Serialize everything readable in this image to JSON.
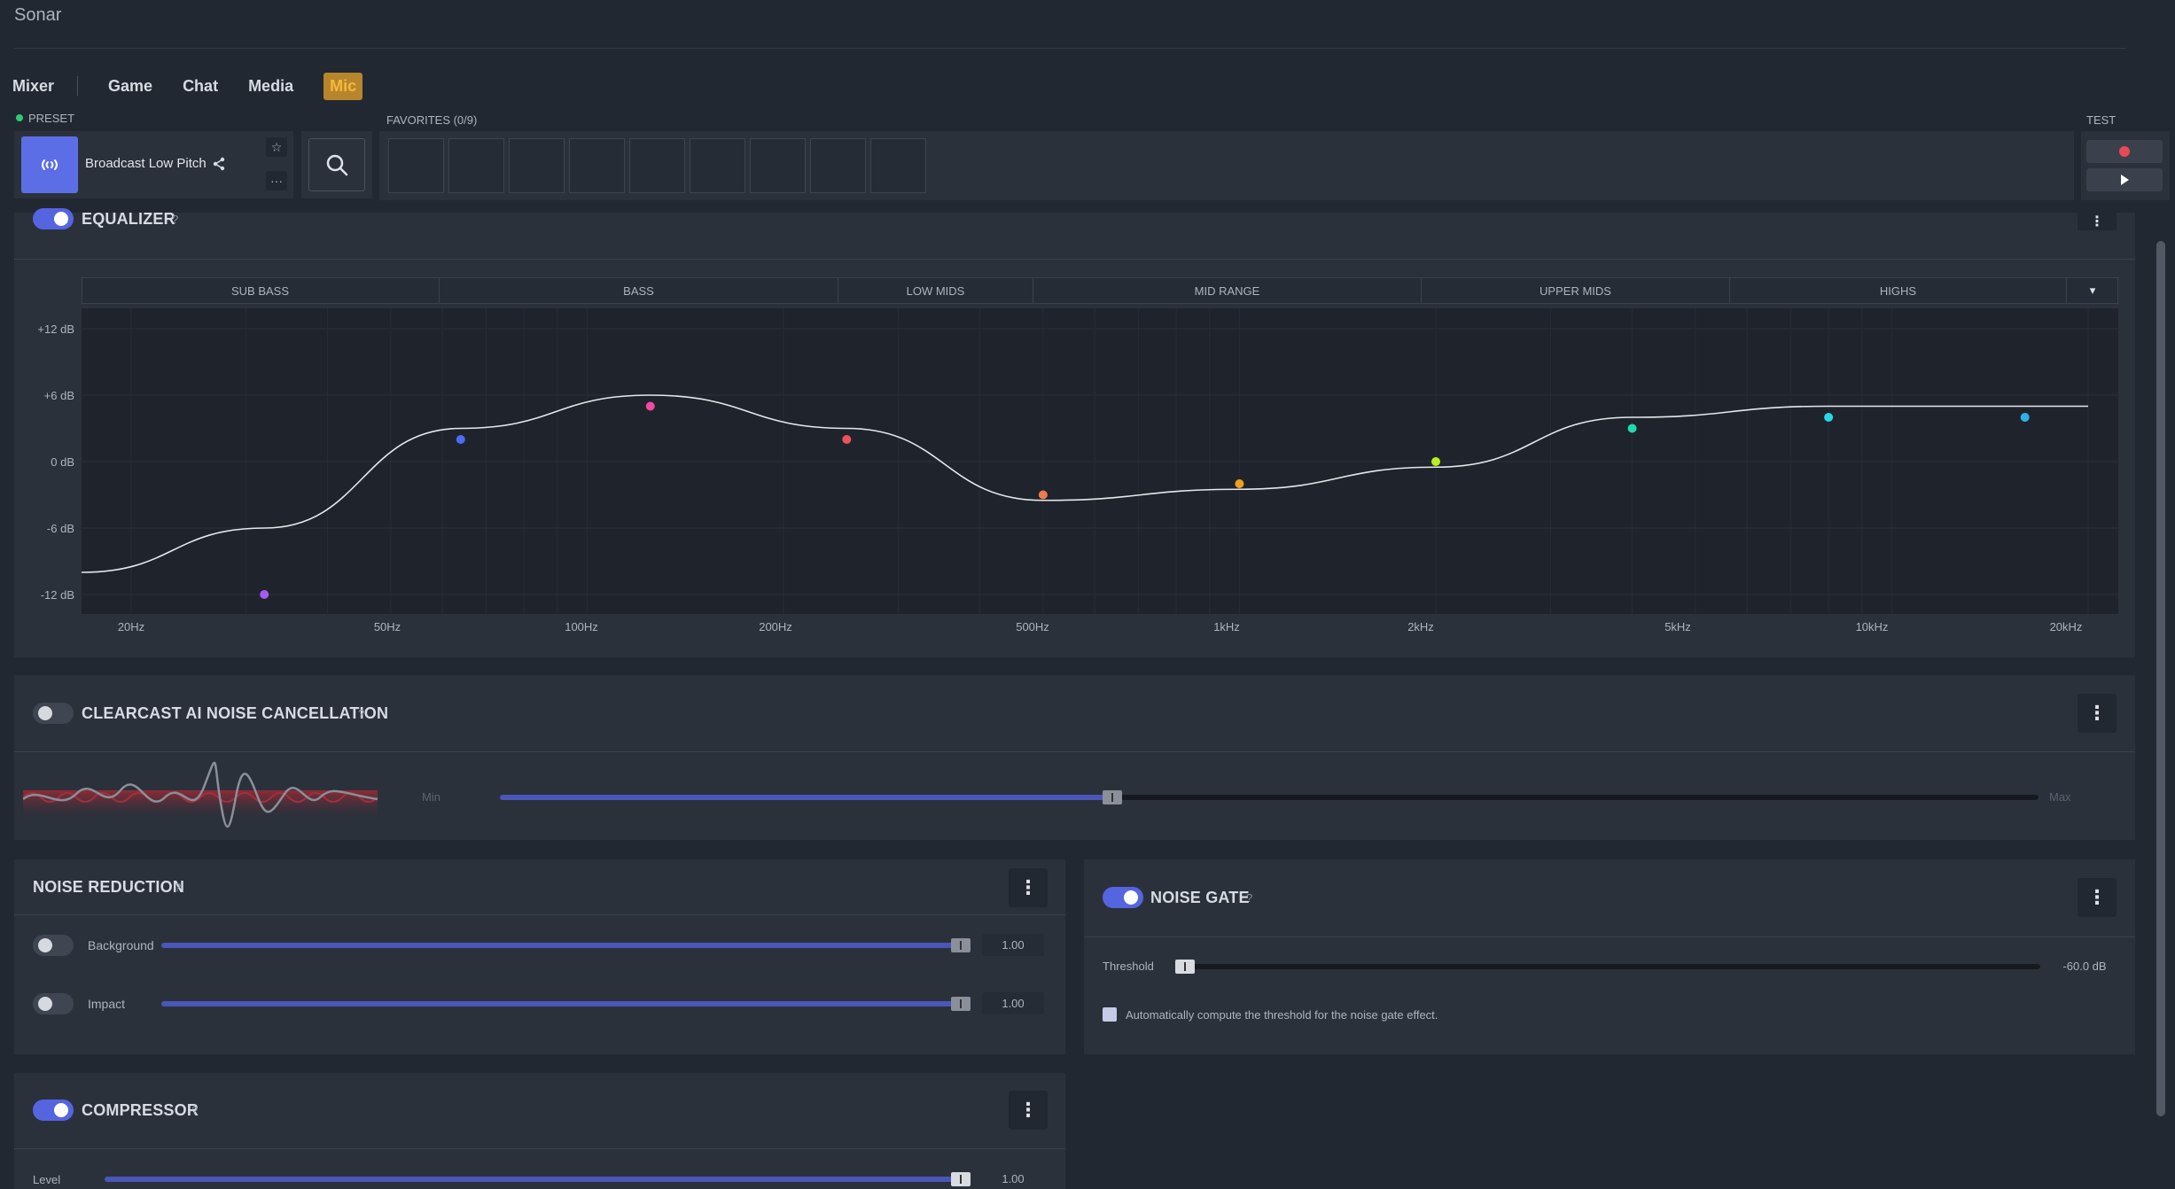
{
  "app": {
    "title": "Sonar"
  },
  "tabs": [
    {
      "label": "Mixer",
      "active": false
    },
    {
      "label": "Game",
      "active": false
    },
    {
      "label": "Chat",
      "active": false
    },
    {
      "label": "Media",
      "active": false
    },
    {
      "label": "Mic",
      "active": true
    }
  ],
  "preset": {
    "label": "PRESET",
    "name": "Broadcast Low Pitch",
    "favorite_icon": "star-icon",
    "more_label": "···"
  },
  "favorites": {
    "label": "FAVORITES (0/9)",
    "slots": 9
  },
  "test": {
    "label": "TEST"
  },
  "equalizer": {
    "title": "EQUALIZER",
    "help": "?",
    "enabled": true,
    "bands": [
      "SUB BASS",
      "BASS",
      "LOW MIDS",
      "MID RANGE",
      "UPPER MIDS",
      "HIGHS"
    ],
    "db_labels": [
      "+12 dB",
      "+6 dB",
      "0 dB",
      "-6 dB",
      "-12 dB"
    ],
    "freq_labels": [
      "20Hz",
      "50Hz",
      "100Hz",
      "200Hz",
      "500Hz",
      "1kHz",
      "2kHz",
      "5kHz",
      "10kHz",
      "20kHz"
    ],
    "points": [
      {
        "freq": 32,
        "gain": -12,
        "color": "#a45cf0"
      },
      {
        "freq": 64,
        "gain": 2,
        "color": "#4f6af5"
      },
      {
        "freq": 125,
        "gain": 5,
        "color": "#f04aa0"
      },
      {
        "freq": 250,
        "gain": 2,
        "color": "#f0505a"
      },
      {
        "freq": 500,
        "gain": -3,
        "color": "#f07a4a"
      },
      {
        "freq": 1000,
        "gain": -2,
        "color": "#f0a020"
      },
      {
        "freq": 2000,
        "gain": 0,
        "color": "#b8f020"
      },
      {
        "freq": 4000,
        "gain": 3,
        "color": "#20d8b0"
      },
      {
        "freq": 8000,
        "gain": 4,
        "color": "#28d8e8"
      },
      {
        "freq": 16000,
        "gain": 4,
        "color": "#30b0e8"
      }
    ]
  },
  "clearcast": {
    "title": "CLEARCAST AI NOISE CANCELLATION",
    "help": "?",
    "enabled": false,
    "min_label": "Min",
    "max_label": "Max",
    "level": 0.4
  },
  "noise_reduction": {
    "title": "NOISE REDUCTION",
    "help": "?",
    "rows": [
      {
        "label": "Background",
        "value": "1.00",
        "enabled": false
      },
      {
        "label": "Impact",
        "value": "1.00",
        "enabled": false
      }
    ]
  },
  "noise_gate": {
    "title": "NOISE GATE",
    "help": "?",
    "enabled": true,
    "threshold_label": "Threshold",
    "threshold_value": "-60.0 dB",
    "auto_label": "Automatically compute the threshold for the noise gate effect."
  },
  "compressor": {
    "title": "COMPRESSOR",
    "help": "?",
    "enabled": true,
    "level_label": "Level",
    "level_value": "1.00"
  },
  "colors": {
    "accent": "#5565e0",
    "active_tab": "#f6b93a",
    "record": "#e84a55",
    "preset_dot": "#2ecc71"
  }
}
